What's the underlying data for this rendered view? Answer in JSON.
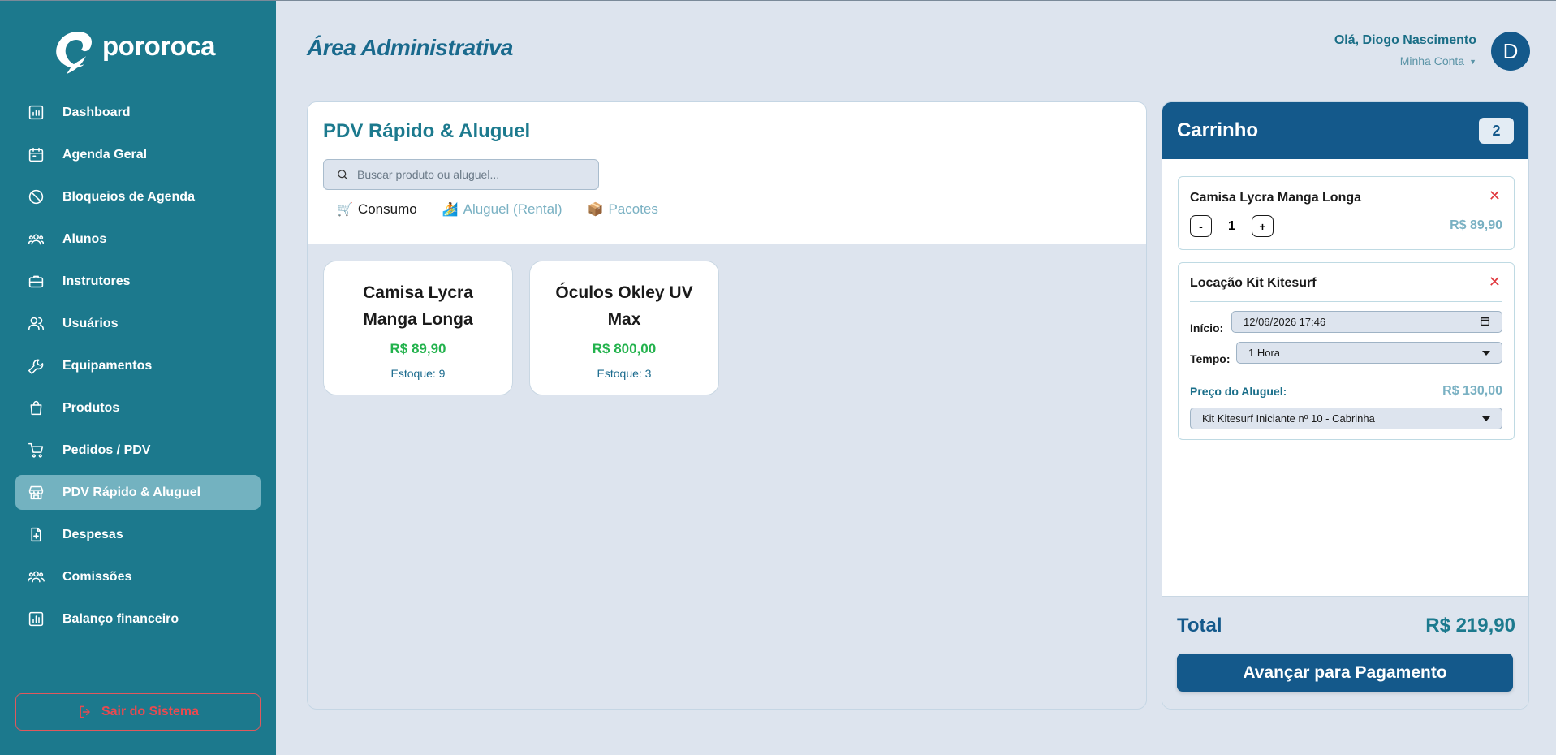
{
  "brand": {
    "name": "pororoca"
  },
  "sidebar": {
    "items": [
      {
        "label": "Dashboard",
        "icon": "chart-icon"
      },
      {
        "label": "Agenda Geral",
        "icon": "calendar-icon"
      },
      {
        "label": "Bloqueios de Agenda",
        "icon": "ban-icon"
      },
      {
        "label": "Alunos",
        "icon": "students-icon"
      },
      {
        "label": "Instrutores",
        "icon": "briefcase-icon"
      },
      {
        "label": "Usuários",
        "icon": "users-icon"
      },
      {
        "label": "Equipamentos",
        "icon": "wrench-icon"
      },
      {
        "label": "Produtos",
        "icon": "bag-icon"
      },
      {
        "label": "Pedidos / PDV",
        "icon": "cart-icon"
      },
      {
        "label": "PDV Rápido & Aluguel",
        "icon": "store-icon",
        "active": true
      },
      {
        "label": "Despesas",
        "icon": "file-plus-icon"
      },
      {
        "label": "Comissões",
        "icon": "group-icon"
      },
      {
        "label": "Balanço financeiro",
        "icon": "bar-chart-icon"
      }
    ],
    "logout_label": "Sair do Sistema"
  },
  "header": {
    "title": "Área Administrativa",
    "greeting": "Olá, Diogo Nascimento",
    "account_label": "Minha Conta",
    "avatar_initial": "D"
  },
  "pos": {
    "title": "PDV Rápido & Aluguel",
    "search_placeholder": "Buscar produto ou aluguel...",
    "tabs": [
      {
        "label": "Consumo",
        "icon": "🛒",
        "active": true
      },
      {
        "label": "Aluguel (Rental)",
        "icon": "🏄",
        "active": false
      },
      {
        "label": "Pacotes",
        "icon": "📦",
        "active": false
      }
    ],
    "products": [
      {
        "name": "Camisa Lycra Manga Longa",
        "price": "R$ 89,90",
        "stock": "Estoque: 9"
      },
      {
        "name": "Óculos Okley UV Max",
        "price": "R$ 800,00",
        "stock": "Estoque: 3"
      }
    ]
  },
  "cart": {
    "title": "Carrinho",
    "count": "2",
    "items": [
      {
        "name": "Camisa Lycra Manga Longa",
        "qty": "1",
        "minus": "-",
        "plus": "+",
        "price": "R$ 89,90",
        "remove": "✕"
      },
      {
        "name": "Locação Kit Kitesurf",
        "remove": "✕",
        "start_label": "Início:",
        "start_value": "12/06/2026 17:46",
        "time_label": "Tempo:",
        "time_value": "1 Hora",
        "rent_label": "Preço do Aluguel:",
        "rent_price": "R$ 130,00",
        "equipment_value": "Kit Kitesurf Iniciante nº 10 - Cabrinha"
      }
    ],
    "total_label": "Total",
    "total_value": "R$ 219,90",
    "pay_label": "Avançar para Pagamento"
  },
  "colors": {
    "sidebar": "#1c798d",
    "primary": "#14598b",
    "price_green": "#22b24c",
    "danger": "#e94a50"
  }
}
